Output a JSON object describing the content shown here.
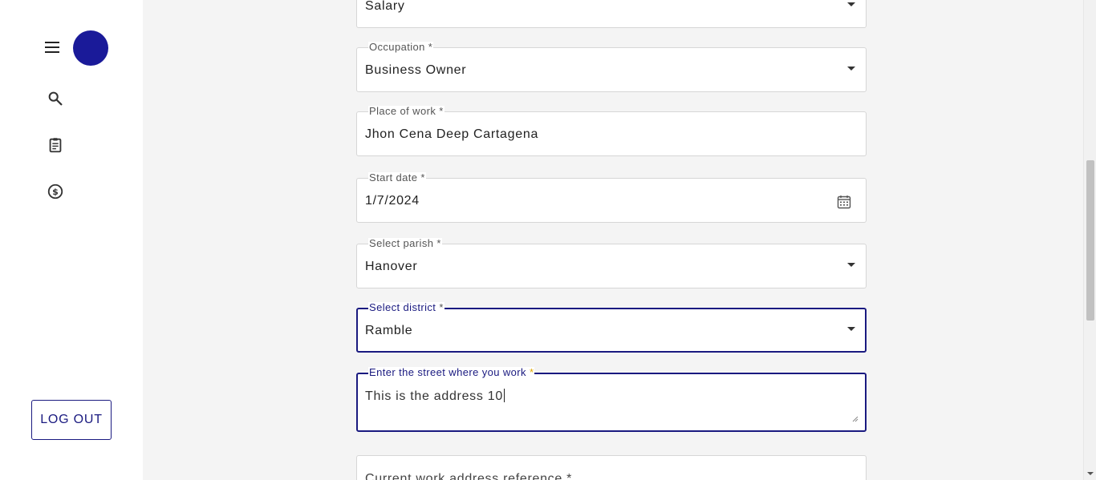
{
  "sidebar": {
    "menu_icon": "hamburger-menu-icon",
    "avatar_color": "#1a1a99",
    "nav": [
      {
        "icon": "search-icon"
      },
      {
        "icon": "clipboard-icon"
      },
      {
        "icon": "dollar-circle-icon"
      }
    ],
    "logout_label": "LOG OUT"
  },
  "form": {
    "income_source": {
      "value": "Salary"
    },
    "occupation": {
      "label": "Occupation *",
      "value": "Business Owner"
    },
    "place_of_work": {
      "label": "Place of work *",
      "value": "Jhon Cena Deep Cartagena"
    },
    "start_date": {
      "label": "Start date *",
      "value": "1/7/2024",
      "icon": "calendar-icon"
    },
    "parish": {
      "label": "Select parish *",
      "value": "Hanover"
    },
    "district": {
      "label": "Select district",
      "required_mark": "*",
      "value": "Ramble"
    },
    "street": {
      "label": "Enter the street where you work",
      "required_mark": "*",
      "value": "This is the address 10"
    },
    "work_address_reference": {
      "placeholder": "Current work address reference *"
    }
  },
  "colors": {
    "accent": "#1a1a80",
    "required_mark_focused": "#e0a800"
  }
}
